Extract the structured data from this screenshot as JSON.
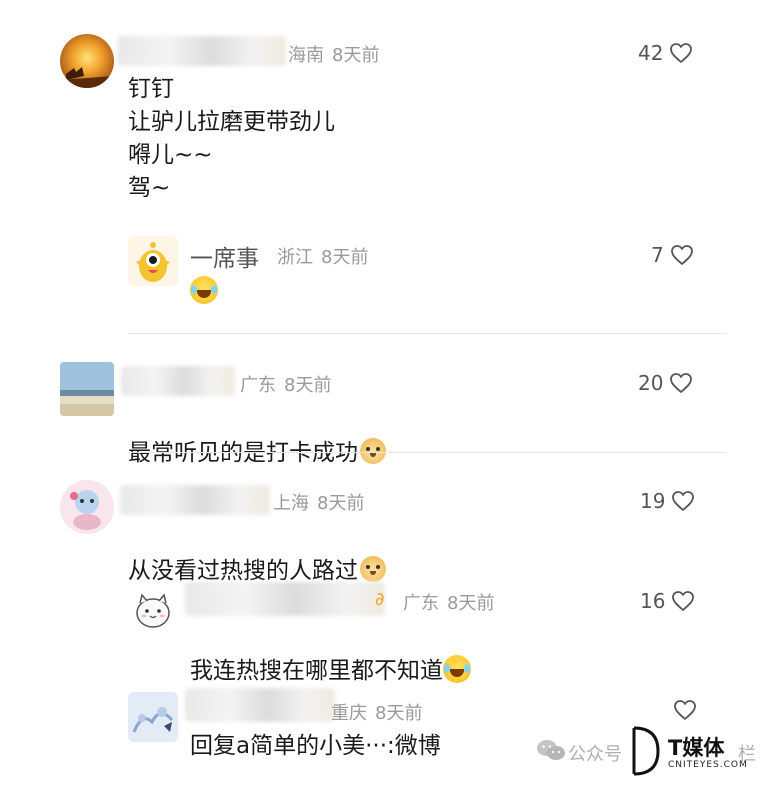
{
  "comments": [
    {
      "location": "海南",
      "time": "8天前",
      "likes": "42",
      "content": "钉钉\n让驴儿拉磨更带劲儿\n嘚儿~~\n驾~",
      "reply": {
        "name": "一席事",
        "location": "浙江",
        "time": "8天前",
        "likes": "7"
      }
    },
    {
      "location": "广东",
      "time": "8天前",
      "likes": "20",
      "content": "最常听见的是打卡成功"
    },
    {
      "location": "上海",
      "time": "8天前",
      "likes": "19",
      "content": "从没看过热搜的人路过",
      "replies": [
        {
          "location": "广东",
          "time": "8天前",
          "likes": "16",
          "content": "我连热搜在哪里都不知道"
        },
        {
          "location": "重庆",
          "time": "8天前",
          "content": "回复a简单的小美···:微博"
        }
      ]
    }
  ],
  "watermark": {
    "wechat_text": "公众号",
    "brand": "T媒体",
    "brand_sub": "CNITEYES.COM",
    "tail": "栏"
  }
}
